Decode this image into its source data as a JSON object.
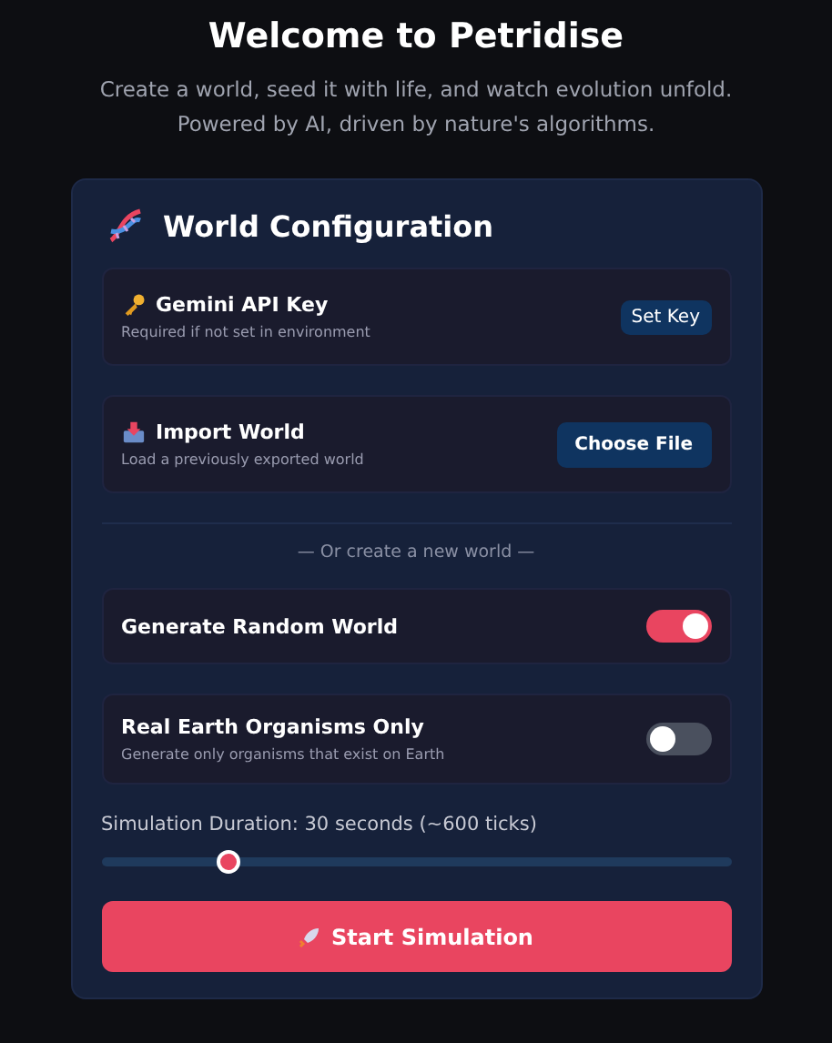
{
  "title": "Welcome to Petridise",
  "subtitle": [
    "Create a world, seed it with life, and watch evolution unfold.",
    "Powered by AI, driven by nature's algorithms."
  ],
  "panel": {
    "heading": "World Configuration",
    "options": [
      {
        "kind": "action",
        "label": "Gemini API Key",
        "hint": "Required if not set in environment",
        "button": "Set Key"
      },
      {
        "kind": "action",
        "label": "Import World",
        "hint": "Load a previously exported world",
        "button": "Choose File"
      }
    ],
    "divider_text": "— Or create a new world —",
    "toggles": [
      {
        "label": "Generate Random World",
        "on": true
      },
      {
        "label": "Real Earth Organisms Only",
        "hint": "Generate only organisms that exist on Earth",
        "on": false
      }
    ],
    "duration": {
      "label": "Simulation Duration: 30 seconds (~600 ticks)",
      "level": 0.2
    },
    "start_button": "Start Simulation"
  }
}
